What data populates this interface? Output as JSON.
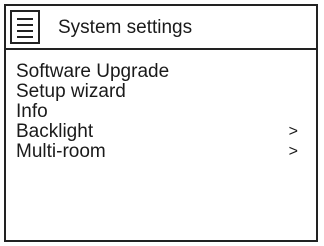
{
  "header": {
    "title": "System settings",
    "icon": "menu-list-icon"
  },
  "menu": {
    "items": [
      {
        "label": "Software Upgrade",
        "chevron": ""
      },
      {
        "label": "Setup wizard",
        "chevron": ""
      },
      {
        "label": "Info",
        "chevron": ""
      },
      {
        "label": "Backlight",
        "chevron": ">"
      },
      {
        "label": "Multi-room",
        "chevron": ">"
      }
    ]
  }
}
